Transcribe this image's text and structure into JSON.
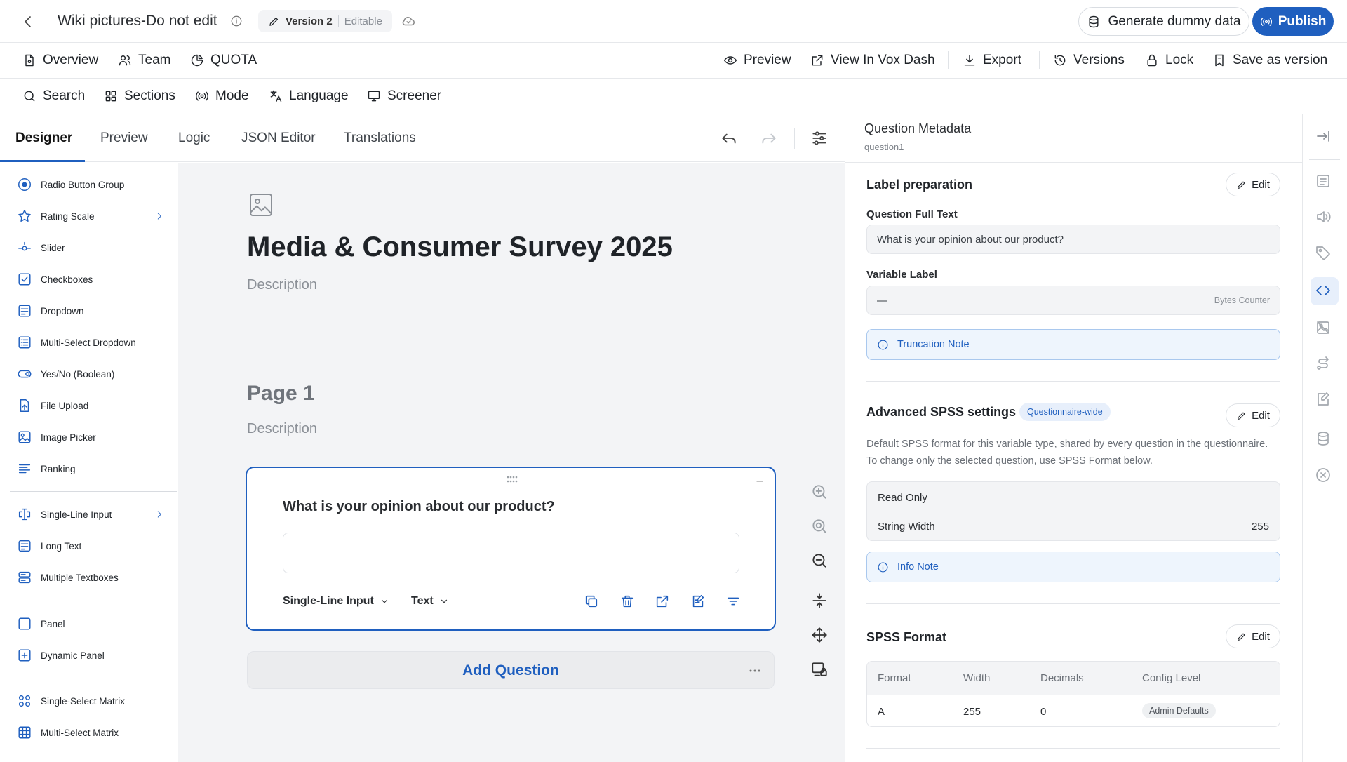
{
  "header": {
    "doc_title": "Wiki pictures-Do not edit",
    "version_label": "Version 2",
    "version_status": "Editable",
    "generate_label": "Generate dummy data",
    "publish_label": "Publish"
  },
  "nav_left": [
    {
      "label": "Overview",
      "icon": "doc-icon"
    },
    {
      "label": "Team",
      "icon": "users-icon"
    },
    {
      "label": "QUOTA",
      "icon": "pie-icon"
    }
  ],
  "nav_right": [
    {
      "label": "Preview",
      "icon": "eye-icon"
    },
    {
      "label": "View In Vox Dash",
      "icon": "external-link-icon"
    },
    {
      "label": "Export",
      "icon": "download-icon"
    },
    {
      "label": "Versions",
      "icon": "history-icon"
    },
    {
      "label": "Lock",
      "icon": "lock-icon"
    },
    {
      "label": "Save as version",
      "icon": "bookmark-icon"
    }
  ],
  "toolbar": [
    {
      "label": "Search",
      "icon": "search-icon"
    },
    {
      "label": "Sections",
      "icon": "grid-icon"
    },
    {
      "label": "Mode",
      "icon": "broadcast-icon"
    },
    {
      "label": "Language",
      "icon": "translate-icon"
    },
    {
      "label": "Screener",
      "icon": "monitor-icon"
    }
  ],
  "tabs": [
    "Designer",
    "Preview",
    "Logic",
    "JSON Editor",
    "Translations"
  ],
  "palette": [
    {
      "label": "Radio Button Group",
      "icon": "radio-icon"
    },
    {
      "label": "Rating Scale",
      "icon": "star-icon",
      "chevron": true
    },
    {
      "label": "Slider",
      "icon": "slider-icon"
    },
    {
      "label": "Checkboxes",
      "icon": "checkbox-icon"
    },
    {
      "label": "Dropdown",
      "icon": "dropdown-icon"
    },
    {
      "label": "Multi-Select Dropdown",
      "icon": "multiselect-icon"
    },
    {
      "label": "Yes/No (Boolean)",
      "icon": "toggle-icon"
    },
    {
      "label": "File Upload",
      "icon": "upload-icon"
    },
    {
      "label": "Image Picker",
      "icon": "image-icon"
    },
    {
      "label": "Ranking",
      "icon": "ranking-icon"
    },
    {
      "label": "Single-Line Input",
      "icon": "text-cursor-icon",
      "chevron": true
    },
    {
      "label": "Long Text",
      "icon": "long-text-icon"
    },
    {
      "label": "Multiple Textboxes",
      "icon": "textboxes-icon"
    },
    {
      "label": "Panel",
      "icon": "panel-icon"
    },
    {
      "label": "Dynamic Panel",
      "icon": "plus-box-icon"
    },
    {
      "label": "Single-Select Matrix",
      "icon": "matrix-radio-icon"
    },
    {
      "label": "Multi-Select Matrix",
      "icon": "matrix-grid-icon"
    }
  ],
  "survey": {
    "title": "Media & Consumer Survey 2025",
    "description": "Description",
    "page_title": "Page 1",
    "page_description": "Description"
  },
  "question": {
    "text": "What is your opinion about our product?",
    "type_label": "Single-Line Input",
    "input_type_label": "Text"
  },
  "add_question_label": "Add Question",
  "metadata": {
    "title": "Question Metadata",
    "subtitle": "question1",
    "label_prep": {
      "title": "Label preparation",
      "edit_label": "Edit",
      "full_text_label": "Question Full Text",
      "full_text_value": "What is your opinion about our product?",
      "variable_label": "Variable Label",
      "variable_value": "—",
      "bytes_counter": "Bytes Counter",
      "truncation_note": "Truncation Note"
    },
    "advanced": {
      "title": "Advanced SPSS settings",
      "badge": "Questionnaire-wide",
      "edit_label": "Edit",
      "description": "Default SPSS format for this variable type, shared by every question in the questionnaire. To change only the selected question, use SPSS Format below.",
      "read_only": "Read Only",
      "string_width_label": "String Width",
      "string_width_value": "255",
      "info_note": "Info Note"
    },
    "spss_format": {
      "title": "SPSS Format",
      "edit_label": "Edit",
      "columns": [
        "Format",
        "Width",
        "Decimals",
        "Config Level"
      ],
      "row": [
        "A",
        "255",
        "0",
        "Admin Defaults"
      ]
    }
  },
  "colors": {
    "accent": "#1f5fbf",
    "canvas_bg": "#f3f4f6",
    "note_bg": "#eef5fd"
  }
}
